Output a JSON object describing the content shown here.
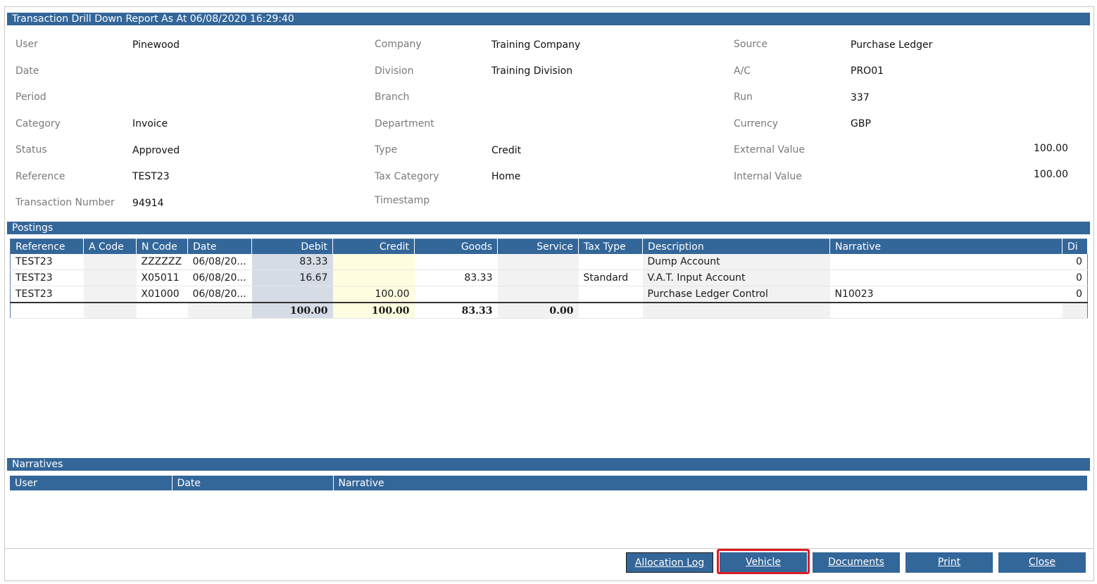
{
  "title": "Transaction Drill Down Report As At 06/08/2020 16:29:40",
  "details": {
    "col1": [
      {
        "label": "User",
        "value": "Pinewood"
      },
      {
        "label": "Date",
        "value": ""
      },
      {
        "label": "Period",
        "value": ""
      },
      {
        "label": "Category",
        "value": "Invoice"
      },
      {
        "label": "Status",
        "value": "Approved"
      },
      {
        "label": "Reference",
        "value": "TEST23"
      },
      {
        "label": "Transaction Number",
        "value": "94914"
      }
    ],
    "col2": [
      {
        "label": "Company",
        "value": "Training Company"
      },
      {
        "label": "Division",
        "value": "Training Division"
      },
      {
        "label": "Branch",
        "value": ""
      },
      {
        "label": "Department",
        "value": ""
      },
      {
        "label": "Type",
        "value": "Credit"
      },
      {
        "label": "Tax Category",
        "value": "Home"
      },
      {
        "label": "Timestamp",
        "value": ""
      }
    ],
    "col3": [
      {
        "label": "Source",
        "value": "Purchase Ledger"
      },
      {
        "label": "A/C",
        "value": "PRO01"
      },
      {
        "label": "Run",
        "value": "337"
      },
      {
        "label": "Currency",
        "value": "GBP"
      },
      {
        "label": "External Value",
        "value": "100.00"
      },
      {
        "label": "Internal Value",
        "value": "100.00"
      }
    ]
  },
  "postings": {
    "title": "Postings",
    "columns": [
      "Reference",
      "A Code",
      "N Code",
      "Date",
      "Debit",
      "Credit",
      "Goods",
      "Service",
      "Tax Type",
      "Description",
      "Narrative",
      "Di"
    ],
    "rows": [
      [
        "TEST23",
        "",
        "ZZZZZZ",
        "06/08/20...",
        "83.33",
        "",
        "",
        "",
        "",
        "Dump Account",
        "",
        "0"
      ],
      [
        "TEST23",
        "",
        "X05011",
        "06/08/20...",
        "16.67",
        "",
        "83.33",
        "",
        "Standard",
        "V.A.T. Input Account",
        "",
        "0"
      ],
      [
        "TEST23",
        "",
        "X01000",
        "06/08/20...",
        "",
        "100.00",
        "",
        "",
        "",
        "Purchase Ledger Control",
        "N10023",
        "0"
      ]
    ],
    "totals": {
      "debit": "100.00",
      "credit": "100.00",
      "goods": "83.33",
      "service": "0.00"
    }
  },
  "narratives": {
    "title": "Narratives",
    "columns": [
      "User",
      "Date",
      "Narrative"
    ]
  },
  "buttons": {
    "allocation_log": "Allocation Log",
    "vehicle": "Vehicle",
    "documents": "Documents",
    "print": "Print",
    "close": "Close"
  },
  "colors": {
    "header": "#336699",
    "highlight": "#e01b24"
  }
}
